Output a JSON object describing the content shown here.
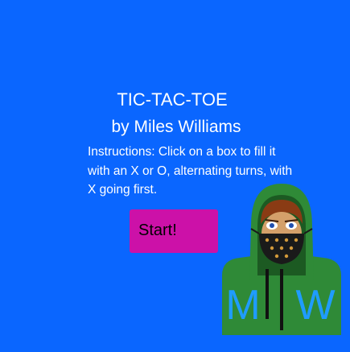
{
  "game": {
    "title": "TIC-TAC-TOE",
    "byline": "by Miles Williams",
    "instructions": "Instructions: Click on a box to fill it with an X or O, alternating turns, with X going first.",
    "start_label": "Start!"
  },
  "avatar": {
    "initials_left": "M",
    "initials_right": "W"
  },
  "colors": {
    "background": "#0a66ff",
    "start_button": "#cc11a8",
    "hoodie": "#2f8a37",
    "hoodie_dark": "#1c5a22",
    "initials": "#1f9cff",
    "mask": "#1a1a1a",
    "mask_dots": "#d39a3a"
  }
}
